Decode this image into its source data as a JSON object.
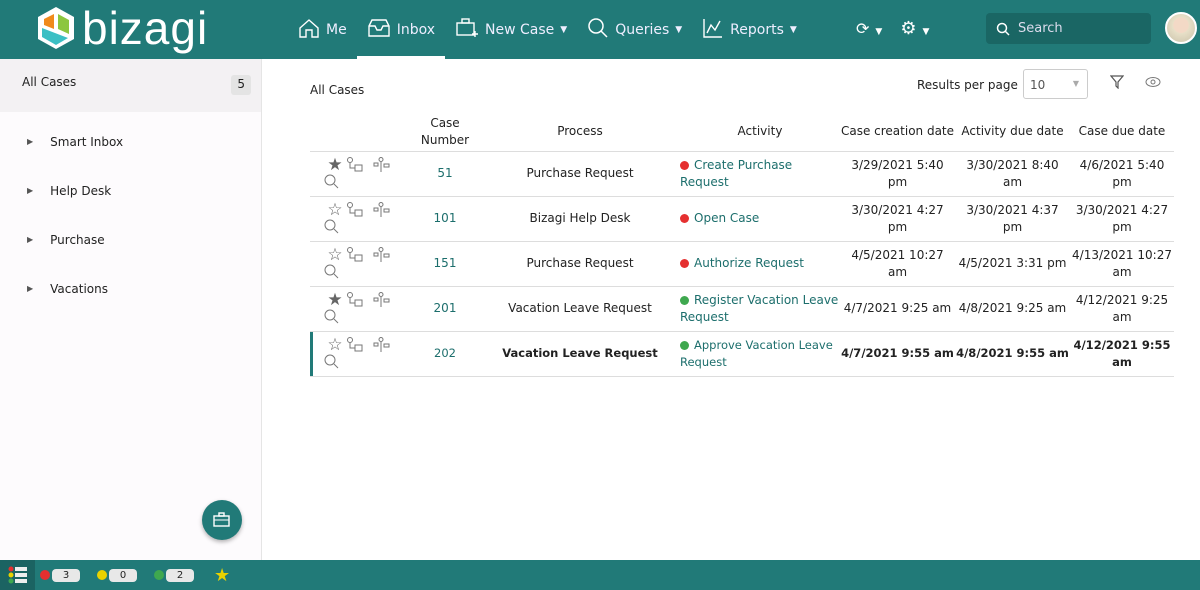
{
  "header": {
    "logo": "bizagi",
    "nav": [
      {
        "label": "Me",
        "icon": "home-icon"
      },
      {
        "label": "Inbox",
        "icon": "inbox-icon",
        "active": true
      },
      {
        "label": "New Case",
        "icon": "new-case-icon",
        "dropdown": true
      },
      {
        "label": "Queries",
        "icon": "search-icon",
        "dropdown": true
      },
      {
        "label": "Reports",
        "icon": "chart-icon",
        "dropdown": true
      }
    ],
    "search_placeholder": "Search"
  },
  "sidebar": {
    "all_cases": "All Cases",
    "all_count": "5",
    "items": [
      {
        "label": "Smart Inbox"
      },
      {
        "label": "Help Desk"
      },
      {
        "label": "Purchase"
      },
      {
        "label": "Vacations"
      }
    ]
  },
  "main": {
    "title": "All Cases",
    "results_label": "Results per page",
    "results_value": "10",
    "columns": [
      "",
      "Case Number",
      "Process",
      "Activity",
      "Case creation date",
      "Activity due date",
      "Case due date"
    ],
    "rows": [
      {
        "starred": true,
        "case": "51",
        "process": "Purchase Request",
        "activity": "Create Purchase Request",
        "status": "red",
        "created": "3/29/2021 5:40 pm",
        "act_due": "3/30/2021 8:40 am",
        "case_due": "4/6/2021 5:40 pm"
      },
      {
        "starred": false,
        "case": "101",
        "process": "Bizagi Help Desk",
        "activity": "Open Case",
        "status": "red",
        "created": "3/30/2021 4:27 pm",
        "act_due": "3/30/2021 4:37 pm",
        "case_due": "3/30/2021 4:27 pm"
      },
      {
        "starred": false,
        "case": "151",
        "process": "Purchase Request",
        "activity": "Authorize Request",
        "status": "red",
        "created": "4/5/2021 10:27 am",
        "act_due": "4/5/2021 3:31 pm",
        "case_due": "4/13/2021 10:27 am"
      },
      {
        "starred": true,
        "case": "201",
        "process": "Vacation Leave Request",
        "activity": "Register Vacation Leave Request",
        "status": "green",
        "created": "4/7/2021 9:25 am",
        "act_due": "4/8/2021 9:25 am",
        "case_due": "4/12/2021 9:25 am"
      },
      {
        "starred": false,
        "case": "202",
        "process": "Vacation Leave Request",
        "activity": "Approve Vacation Leave Request",
        "status": "green",
        "created": "4/7/2021 9:55 am",
        "act_due": "4/8/2021 9:55 am",
        "case_due": "4/12/2021 9:55 am",
        "bold": true
      }
    ]
  },
  "footer": {
    "red": "3",
    "yellow": "0",
    "green": "2"
  },
  "colors": {
    "primary": "#217a78",
    "red": "#e53030",
    "yellow": "#e8d200",
    "green": "#3fa84f"
  }
}
